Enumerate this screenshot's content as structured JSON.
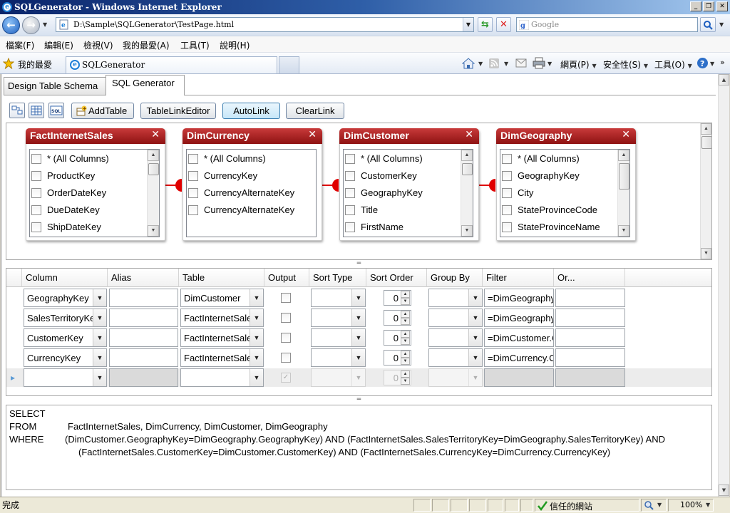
{
  "window": {
    "title": "SQLGenerator - Windows Internet Explorer"
  },
  "nav": {
    "address": "D:\\Sample\\SQLGenerator\\TestPage.html",
    "search_placeholder": "Google"
  },
  "menu": {
    "items": [
      "檔案(F)",
      "編輯(E)",
      "檢視(V)",
      "我的最愛(A)",
      "工具(T)",
      "說明(H)"
    ]
  },
  "favorites": {
    "label": "我的最愛",
    "tab_title": "SQLGenerator",
    "toolbar": {
      "page": "網頁(P)",
      "safety": "安全性(S)",
      "tools": "工具(O)"
    }
  },
  "app": {
    "tabs": [
      {
        "label": "Design Table Schema",
        "selected": false
      },
      {
        "label": "SQL Generator",
        "selected": true
      }
    ]
  },
  "toolbar": {
    "icons": [
      "layout-icon",
      "grid-icon",
      "sql-icon"
    ],
    "buttons": [
      "AddTable",
      "TableLinkEditor",
      "AutoLink",
      "ClearLink"
    ]
  },
  "canvas": {
    "tables": [
      {
        "name": "FactInternetSales",
        "columns": [
          "* (All Columns)",
          "ProductKey",
          "OrderDateKey",
          "DueDateKey",
          "ShipDateKey"
        ]
      },
      {
        "name": "DimCurrency",
        "columns": [
          "* (All Columns)",
          "CurrencyKey",
          "CurrencyAlternateKey",
          "CurrencyAlternateKey"
        ]
      },
      {
        "name": "DimCustomer",
        "columns": [
          "* (All Columns)",
          "CustomerKey",
          "GeographyKey",
          "Title",
          "FirstName"
        ]
      },
      {
        "name": "DimGeography",
        "columns": [
          "* (All Columns)",
          "GeographyKey",
          "City",
          "StateProvinceCode",
          "StateProvinceName"
        ]
      }
    ],
    "links": [
      [
        "FactInternetSales",
        "DimCurrency"
      ],
      [
        "DimCurrency",
        "DimCustomer"
      ],
      [
        "DimCustomer",
        "DimGeography"
      ]
    ]
  },
  "grid": {
    "headers": [
      "Column",
      "Alias",
      "Table",
      "Output",
      "Sort Type",
      "Sort Order",
      "Group By",
      "Filter",
      "Or..."
    ],
    "rows": [
      {
        "column": "GeographyKey",
        "alias": "",
        "table": "DimCustomer",
        "output": false,
        "sort_type": "",
        "sort_order": "0",
        "group_by": "",
        "filter": "=DimGeography.GeographyKey",
        "or": ""
      },
      {
        "column": "SalesTerritoryKey",
        "alias": "",
        "table": "FactInternetSales",
        "output": false,
        "sort_type": "",
        "sort_order": "0",
        "group_by": "",
        "filter": "=DimGeography.SalesTerritoryKey",
        "or": ""
      },
      {
        "column": "CustomerKey",
        "alias": "",
        "table": "FactInternetSales",
        "output": false,
        "sort_type": "",
        "sort_order": "0",
        "group_by": "",
        "filter": "=DimCustomer.CustomerKey",
        "or": ""
      },
      {
        "column": "CurrencyKey",
        "alias": "",
        "table": "FactInternetSales",
        "output": false,
        "sort_type": "",
        "sort_order": "0",
        "group_by": "",
        "filter": "=DimCurrency.CurrencyKey",
        "or": ""
      }
    ],
    "new_row": {
      "column": "",
      "table": "",
      "output": true,
      "sort_order": "0"
    }
  },
  "sql": {
    "lines": [
      {
        "keyword": "SELECT",
        "text": ""
      },
      {
        "keyword": "FROM",
        "text": "FactInternetSales, DimCurrency, DimCustomer, DimGeography"
      },
      {
        "keyword": "WHERE",
        "text": "(DimCustomer.GeographyKey=DimGeography.GeographyKey) AND (FactInternetSales.SalesTerritoryKey=DimGeography.SalesTerritoryKey) AND"
      },
      {
        "keyword": "",
        "text": "(FactInternetSales.CustomerKey=DimCustomer.CustomerKey) AND (FactInternetSales.CurrencyKey=DimCurrency.CurrencyKey)"
      }
    ]
  },
  "status": {
    "text": "完成",
    "zone": "信任的網站",
    "zoom": "100%"
  },
  "colors": {
    "table_header": "#a51e1e",
    "link": "#e00000",
    "titlebar": "#0a246a",
    "focus_button": "#c6e6f8"
  }
}
